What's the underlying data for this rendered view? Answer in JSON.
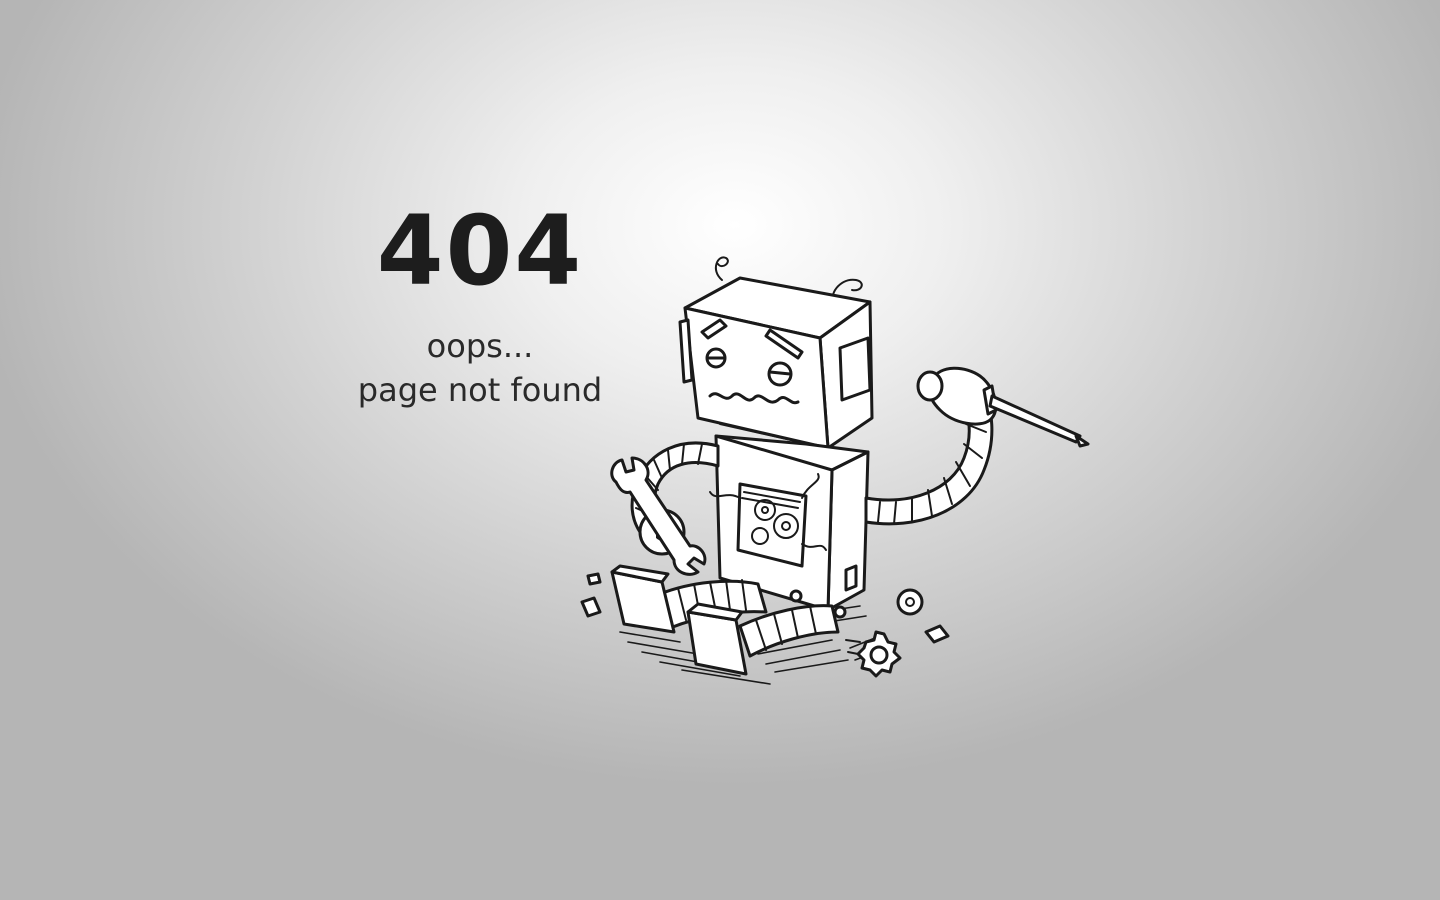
{
  "error": {
    "code": "404",
    "line1": "oops...",
    "line2": "page not found"
  },
  "illustration": {
    "icon": "broken-robot-icon"
  },
  "colors": {
    "background_center": "#ffffff",
    "background_edge": "#b5b5b5",
    "text": "#1d1d1d"
  }
}
